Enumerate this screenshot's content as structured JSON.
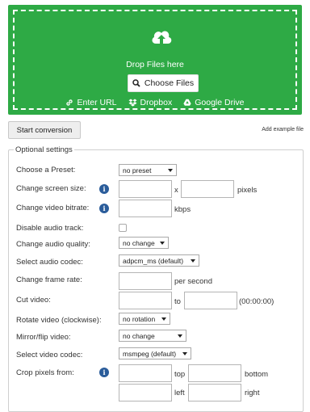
{
  "dropzone": {
    "drop_text": "Drop Files here",
    "choose_label": "Choose Files",
    "sources": [
      "Enter URL",
      "Dropbox",
      "Google Drive"
    ],
    "color": "#2eaa45"
  },
  "actions": {
    "start_label": "Start conversion",
    "add_example": "Add example file"
  },
  "settings": {
    "legend": "Optional settings",
    "preset_label": "Choose a Preset:",
    "preset_value": "no preset",
    "screen_size_label": "Change screen size:",
    "screen_size_x": "x",
    "screen_size_unit": "pixels",
    "bitrate_label": "Change video bitrate:",
    "bitrate_unit": "kbps",
    "disable_audio_label": "Disable audio track:",
    "audio_quality_label": "Change audio quality:",
    "audio_quality_value": "no change",
    "audio_codec_label": "Select audio codec:",
    "audio_codec_value": "adpcm_ms (default)",
    "frame_rate_label": "Change frame rate:",
    "frame_rate_unit": "per second",
    "cut_label": "Cut video:",
    "cut_to": "to",
    "cut_format": "(00:00:00)",
    "rotate_label": "Rotate video (clockwise):",
    "rotate_value": "no rotation",
    "mirror_label": "Mirror/flip video:",
    "mirror_value": "no change",
    "video_codec_label": "Select video codec:",
    "video_codec_value": "msmpeg (default)",
    "crop_label": "Crop pixels from:",
    "crop_top": "top",
    "crop_bottom": "bottom",
    "crop_left": "left",
    "crop_right": "right",
    "info_icon_glyph": "i",
    "info_color": "#2a5c9a"
  }
}
